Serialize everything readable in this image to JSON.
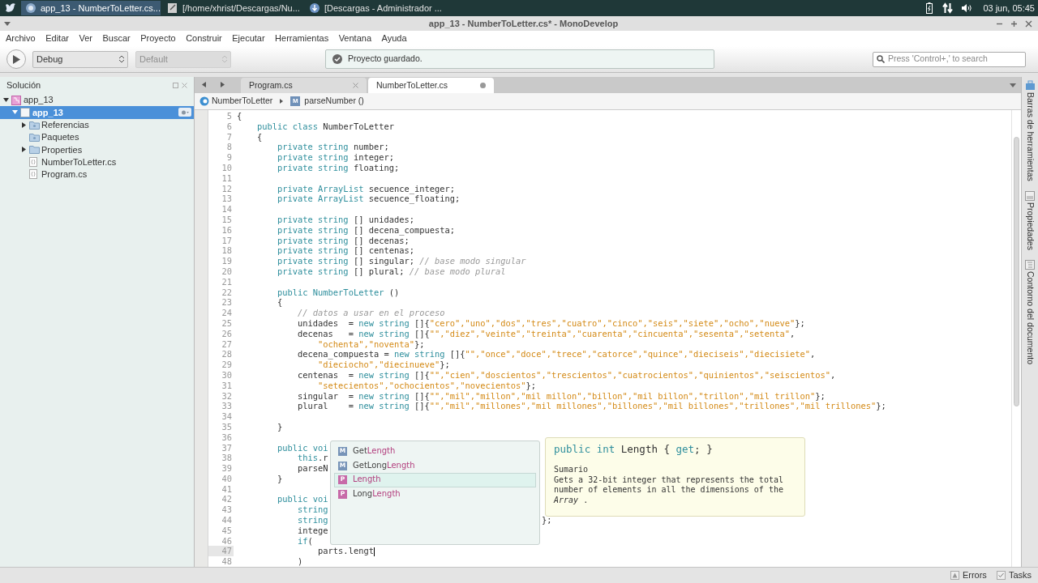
{
  "taskbar": {
    "tasks": [
      {
        "label": "app_13 - NumberToLetter.cs...",
        "kind": "ide",
        "selected": true
      },
      {
        "label": "[/home/xhrist/Descargas/Nu...",
        "kind": "editor",
        "selected": false
      },
      {
        "label": "[Descargas - Administrador ...",
        "kind": "download",
        "selected": false
      }
    ],
    "clock": "03 jun, 05:45"
  },
  "window": {
    "title": "app_13 - NumberToLetter.cs* - MonoDevelop"
  },
  "menu": [
    "Archivo",
    "Editar",
    "Ver",
    "Buscar",
    "Proyecto",
    "Construir",
    "Ejecutar",
    "Herramientas",
    "Ventana",
    "Ayuda"
  ],
  "toolbar": {
    "config": {
      "value": "Debug",
      "disabled": false
    },
    "platform": {
      "value": "Default",
      "disabled": true
    },
    "status": "Proyecto guardado.",
    "search_placeholder": "Press 'Control+,' to search"
  },
  "solution": {
    "title": "Solución",
    "tree": [
      {
        "label": "app_13",
        "kind": "solution",
        "expanded": true,
        "selected": false,
        "children": [
          {
            "label": "app_13",
            "kind": "project",
            "expanded": true,
            "selected": true,
            "children": [
              {
                "label": "Referencias",
                "kind": "references",
                "expanded": false,
                "selected": false
              },
              {
                "label": "Paquetes",
                "kind": "packages",
                "selected": false
              },
              {
                "label": "Properties",
                "kind": "folder",
                "expanded": false,
                "selected": false
              },
              {
                "label": "NumberToLetter.cs",
                "kind": "file",
                "selected": false
              },
              {
                "label": "Program.cs",
                "kind": "file",
                "selected": false
              }
            ]
          }
        ]
      }
    ]
  },
  "editor": {
    "tabs": [
      {
        "label": "Program.cs",
        "selected": false,
        "modified": false
      },
      {
        "label": "NumberToLetter.cs",
        "selected": true,
        "modified": true
      }
    ],
    "breadcrumb": {
      "class": "NumberToLetter",
      "method_icon": "M",
      "method": "parseNumber ()"
    },
    "lines": [
      {
        "n": "5",
        "current": false,
        "t": [
          {
            "kind": "plain",
            "text": "{"
          }
        ]
      },
      {
        "n": "6",
        "current": false,
        "t": [
          {
            "kind": "keyword",
            "text": "    public class "
          },
          {
            "kind": "plain",
            "text": "NumberToLetter"
          }
        ]
      },
      {
        "n": "7",
        "current": false,
        "t": [
          {
            "kind": "plain",
            "text": "    {"
          }
        ]
      },
      {
        "n": "8",
        "current": false,
        "t": [
          {
            "kind": "keyword",
            "text": "        private string "
          },
          {
            "kind": "plain",
            "text": "number;"
          }
        ]
      },
      {
        "n": "9",
        "current": false,
        "t": [
          {
            "kind": "keyword",
            "text": "        private string "
          },
          {
            "kind": "plain",
            "text": "integer;"
          }
        ]
      },
      {
        "n": "10",
        "current": false,
        "t": [
          {
            "kind": "keyword",
            "text": "        private string "
          },
          {
            "kind": "plain",
            "text": "floating;"
          }
        ]
      },
      {
        "n": "11",
        "current": false
      },
      {
        "n": "12",
        "current": false,
        "t": [
          {
            "kind": "keyword",
            "text": "        private ArrayList "
          },
          {
            "kind": "plain",
            "text": "secuence_integer;"
          }
        ]
      },
      {
        "n": "13",
        "current": false,
        "t": [
          {
            "kind": "keyword",
            "text": "        private ArrayList "
          },
          {
            "kind": "plain",
            "text": "secuence_floating;"
          }
        ]
      },
      {
        "n": "14",
        "current": false
      },
      {
        "n": "15",
        "current": false,
        "t": [
          {
            "kind": "keyword",
            "text": "        private string "
          },
          {
            "kind": "plain",
            "text": "[] unidades;"
          }
        ]
      },
      {
        "n": "16",
        "current": false,
        "t": [
          {
            "kind": "keyword",
            "text": "        private string "
          },
          {
            "kind": "plain",
            "text": "[] decena_compuesta;"
          }
        ]
      },
      {
        "n": "17",
        "current": false,
        "t": [
          {
            "kind": "keyword",
            "text": "        private string "
          },
          {
            "kind": "plain",
            "text": "[] decenas;"
          }
        ]
      },
      {
        "n": "18",
        "current": false,
        "t": [
          {
            "kind": "keyword",
            "text": "        private string "
          },
          {
            "kind": "plain",
            "text": "[] centenas;"
          }
        ]
      },
      {
        "n": "19",
        "current": false,
        "t": [
          {
            "kind": "keyword",
            "text": "        private string "
          },
          {
            "kind": "plain",
            "text": "[] singular; "
          },
          {
            "kind": "comment",
            "text": "// base modo singular"
          }
        ]
      },
      {
        "n": "20",
        "current": false,
        "t": [
          {
            "kind": "keyword",
            "text": "        private string "
          },
          {
            "kind": "plain",
            "text": "[] plural; "
          },
          {
            "kind": "comment",
            "text": "// base modo plural"
          }
        ]
      },
      {
        "n": "21",
        "current": false
      },
      {
        "n": "22",
        "current": false,
        "t": [
          {
            "kind": "keyword",
            "text": "        public NumberToLetter "
          },
          {
            "kind": "plain",
            "text": "()"
          }
        ]
      },
      {
        "n": "23",
        "current": false,
        "t": [
          {
            "kind": "plain",
            "text": "        {"
          }
        ]
      },
      {
        "n": "24",
        "current": false,
        "t": [
          {
            "kind": "comment",
            "text": "            // datos a usar en el proceso"
          }
        ]
      },
      {
        "n": "25",
        "current": false,
        "t": [
          {
            "kind": "plain",
            "text": "            unidades  = "
          },
          {
            "kind": "keyword",
            "text": "new string "
          },
          {
            "kind": "plain",
            "text": "[]{"
          },
          {
            "kind": "string",
            "text": "\"cero\",\"uno\",\"dos\",\"tres\",\"cuatro\",\"cinco\",\"seis\",\"siete\",\"ocho\",\"nueve\""
          },
          {
            "kind": "plain",
            "text": "};"
          }
        ]
      },
      {
        "n": "26",
        "current": false,
        "t": [
          {
            "kind": "plain",
            "text": "            decenas   = "
          },
          {
            "kind": "keyword",
            "text": "new string "
          },
          {
            "kind": "plain",
            "text": "[]{"
          },
          {
            "kind": "string",
            "text": "\"\",\"diez\",\"veinte\",\"treinta\",\"cuarenta\",\"cincuenta\",\"sesenta\",\"setenta\""
          },
          {
            "kind": "plain",
            "text": ","
          }
        ]
      },
      {
        "n": "27",
        "current": false,
        "t": [
          {
            "kind": "string",
            "text": "                \"ochenta\",\"noventa\""
          },
          {
            "kind": "plain",
            "text": "};"
          }
        ]
      },
      {
        "n": "28",
        "current": false,
        "t": [
          {
            "kind": "plain",
            "text": "            decena_compuesta = "
          },
          {
            "kind": "keyword",
            "text": "new string "
          },
          {
            "kind": "plain",
            "text": "[]{"
          },
          {
            "kind": "string",
            "text": "\"\",\"once\",\"doce\",\"trece\",\"catorce\",\"quince\",\"dieciseis\",\"diecisiete\""
          },
          {
            "kind": "plain",
            "text": ","
          }
        ]
      },
      {
        "n": "29",
        "current": false,
        "t": [
          {
            "kind": "string",
            "text": "                \"dieciocho\",\"diecinueve\""
          },
          {
            "kind": "plain",
            "text": "};"
          }
        ]
      },
      {
        "n": "30",
        "current": false,
        "t": [
          {
            "kind": "plain",
            "text": "            centenas  = "
          },
          {
            "kind": "keyword",
            "text": "new string "
          },
          {
            "kind": "plain",
            "text": "[]{"
          },
          {
            "kind": "string",
            "text": "\"\",\"cien\",\"doscientos\",\"trescientos\",\"cuatrocientos\",\"quinientos\",\"seiscientos\""
          },
          {
            "kind": "plain",
            "text": ","
          }
        ]
      },
      {
        "n": "31",
        "current": false,
        "t": [
          {
            "kind": "string",
            "text": "                \"setecientos\",\"ochocientos\",\"novecientos\""
          },
          {
            "kind": "plain",
            "text": "};"
          }
        ]
      },
      {
        "n": "32",
        "current": false,
        "t": [
          {
            "kind": "plain",
            "text": "            singular  = "
          },
          {
            "kind": "keyword",
            "text": "new string "
          },
          {
            "kind": "plain",
            "text": "[]{"
          },
          {
            "kind": "string",
            "text": "\"\",\"mil\",\"millon\",\"mil millon\",\"billon\",\"mil billon\",\"trillon\",\"mil trillon\""
          },
          {
            "kind": "plain",
            "text": "};"
          }
        ]
      },
      {
        "n": "33",
        "current": false,
        "t": [
          {
            "kind": "plain",
            "text": "            plural    = "
          },
          {
            "kind": "keyword",
            "text": "new string "
          },
          {
            "kind": "plain",
            "text": "[]{"
          },
          {
            "kind": "string",
            "text": "\"\",\"mil\",\"millones\",\"mil millones\",\"billones\",\"mil billones\",\"trillones\",\"mil trillones\""
          },
          {
            "kind": "plain",
            "text": "};"
          }
        ]
      },
      {
        "n": "34",
        "current": false
      },
      {
        "n": "35",
        "current": false,
        "t": [
          {
            "kind": "plain",
            "text": "        }"
          }
        ]
      },
      {
        "n": "36",
        "current": false
      },
      {
        "n": "37",
        "current": false,
        "t": [
          {
            "kind": "keyword",
            "text": "        public voi"
          }
        ]
      },
      {
        "n": "38",
        "current": false,
        "t": [
          {
            "kind": "keyword",
            "text": "            this"
          },
          {
            "kind": "plain",
            "text": ".r"
          }
        ]
      },
      {
        "n": "39",
        "current": false,
        "t": [
          {
            "kind": "plain",
            "text": "            parseN"
          }
        ]
      },
      {
        "n": "40",
        "current": false,
        "t": [
          {
            "kind": "plain",
            "text": "        }"
          }
        ]
      },
      {
        "n": "41",
        "current": false
      },
      {
        "n": "42",
        "current": false,
        "t": [
          {
            "kind": "keyword",
            "text": "        public voi"
          }
        ]
      },
      {
        "n": "43",
        "current": false,
        "t": [
          {
            "kind": "keyword",
            "text": "            string"
          }
        ]
      },
      {
        "n": "44",
        "current": false,
        "t": [
          {
            "kind": "keyword",
            "text": "            string"
          }
        ],
        "tail": "};"
      },
      {
        "n": "45",
        "current": false,
        "t": [
          {
            "kind": "plain",
            "text": "            intege"
          }
        ]
      },
      {
        "n": "46",
        "current": false,
        "t": [
          {
            "kind": "keyword",
            "text": "            if"
          },
          {
            "kind": "plain",
            "text": "("
          }
        ]
      },
      {
        "n": "47",
        "current": true,
        "t": [
          {
            "kind": "plain",
            "text": "                parts.lengt"
          }
        ]
      },
      {
        "n": "48",
        "current": false,
        "t": [
          {
            "kind": "plain",
            "text": "            )"
          }
        ]
      }
    ],
    "completion": {
      "items": [
        {
          "kind": "method",
          "icon": "M",
          "pre": "Get",
          "match": "Length",
          "selected": false
        },
        {
          "kind": "method",
          "icon": "M",
          "pre": "GetLong",
          "match": "Length",
          "selected": false
        },
        {
          "kind": "property",
          "icon": "P",
          "match": "Length",
          "selected": true
        },
        {
          "kind": "property",
          "icon": "P",
          "pre": "Long",
          "match": "Length",
          "selected": false
        }
      ]
    },
    "tooltip": {
      "signature": [
        {
          "kind": "keyword",
          "text": "public int "
        },
        {
          "kind": "plain",
          "text": "Length { "
        },
        {
          "kind": "keyword",
          "text": "get"
        },
        {
          "kind": "plain",
          "text": "; }"
        }
      ],
      "heading": "Sumario",
      "text": "Gets a 32-bit integer that represents the total number of elements in all the dimensions of the *Array* ."
    }
  },
  "side_pads": [
    {
      "label": "Barras de herramientas",
      "kind": "toolbox"
    },
    {
      "label": "Propiedades",
      "kind": "properties"
    },
    {
      "label": "Contorno del documento",
      "kind": "outline"
    }
  ],
  "status_bar": {
    "errors": "Errors",
    "tasks": "Tasks"
  }
}
